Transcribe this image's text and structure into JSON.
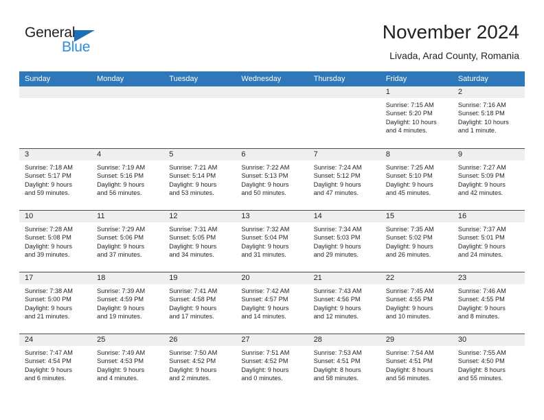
{
  "brand": {
    "name_part1": "General",
    "name_part2": "Blue",
    "accent_color": "#2b8ddc",
    "triangle_color": "#1f6fb5"
  },
  "header": {
    "title": "November 2024",
    "location": "Livada, Arad County, Romania"
  },
  "calendar": {
    "header_color": "#2e77b8",
    "daynum_band_color": "#efeff0",
    "weekday_headers": [
      "Sunday",
      "Monday",
      "Tuesday",
      "Wednesday",
      "Thursday",
      "Friday",
      "Saturday"
    ],
    "weeks": [
      [
        {
          "day": "",
          "lines": []
        },
        {
          "day": "",
          "lines": []
        },
        {
          "day": "",
          "lines": []
        },
        {
          "day": "",
          "lines": []
        },
        {
          "day": "",
          "lines": []
        },
        {
          "day": "1",
          "lines": [
            "Sunrise: 7:15 AM",
            "Sunset: 5:20 PM",
            "Daylight: 10 hours",
            "and 4 minutes."
          ]
        },
        {
          "day": "2",
          "lines": [
            "Sunrise: 7:16 AM",
            "Sunset: 5:18 PM",
            "Daylight: 10 hours",
            "and 1 minute."
          ]
        }
      ],
      [
        {
          "day": "3",
          "lines": [
            "Sunrise: 7:18 AM",
            "Sunset: 5:17 PM",
            "Daylight: 9 hours",
            "and 59 minutes."
          ]
        },
        {
          "day": "4",
          "lines": [
            "Sunrise: 7:19 AM",
            "Sunset: 5:16 PM",
            "Daylight: 9 hours",
            "and 56 minutes."
          ]
        },
        {
          "day": "5",
          "lines": [
            "Sunrise: 7:21 AM",
            "Sunset: 5:14 PM",
            "Daylight: 9 hours",
            "and 53 minutes."
          ]
        },
        {
          "day": "6",
          "lines": [
            "Sunrise: 7:22 AM",
            "Sunset: 5:13 PM",
            "Daylight: 9 hours",
            "and 50 minutes."
          ]
        },
        {
          "day": "7",
          "lines": [
            "Sunrise: 7:24 AM",
            "Sunset: 5:12 PM",
            "Daylight: 9 hours",
            "and 47 minutes."
          ]
        },
        {
          "day": "8",
          "lines": [
            "Sunrise: 7:25 AM",
            "Sunset: 5:10 PM",
            "Daylight: 9 hours",
            "and 45 minutes."
          ]
        },
        {
          "day": "9",
          "lines": [
            "Sunrise: 7:27 AM",
            "Sunset: 5:09 PM",
            "Daylight: 9 hours",
            "and 42 minutes."
          ]
        }
      ],
      [
        {
          "day": "10",
          "lines": [
            "Sunrise: 7:28 AM",
            "Sunset: 5:08 PM",
            "Daylight: 9 hours",
            "and 39 minutes."
          ]
        },
        {
          "day": "11",
          "lines": [
            "Sunrise: 7:29 AM",
            "Sunset: 5:06 PM",
            "Daylight: 9 hours",
            "and 37 minutes."
          ]
        },
        {
          "day": "12",
          "lines": [
            "Sunrise: 7:31 AM",
            "Sunset: 5:05 PM",
            "Daylight: 9 hours",
            "and 34 minutes."
          ]
        },
        {
          "day": "13",
          "lines": [
            "Sunrise: 7:32 AM",
            "Sunset: 5:04 PM",
            "Daylight: 9 hours",
            "and 31 minutes."
          ]
        },
        {
          "day": "14",
          "lines": [
            "Sunrise: 7:34 AM",
            "Sunset: 5:03 PM",
            "Daylight: 9 hours",
            "and 29 minutes."
          ]
        },
        {
          "day": "15",
          "lines": [
            "Sunrise: 7:35 AM",
            "Sunset: 5:02 PM",
            "Daylight: 9 hours",
            "and 26 minutes."
          ]
        },
        {
          "day": "16",
          "lines": [
            "Sunrise: 7:37 AM",
            "Sunset: 5:01 PM",
            "Daylight: 9 hours",
            "and 24 minutes."
          ]
        }
      ],
      [
        {
          "day": "17",
          "lines": [
            "Sunrise: 7:38 AM",
            "Sunset: 5:00 PM",
            "Daylight: 9 hours",
            "and 21 minutes."
          ]
        },
        {
          "day": "18",
          "lines": [
            "Sunrise: 7:39 AM",
            "Sunset: 4:59 PM",
            "Daylight: 9 hours",
            "and 19 minutes."
          ]
        },
        {
          "day": "19",
          "lines": [
            "Sunrise: 7:41 AM",
            "Sunset: 4:58 PM",
            "Daylight: 9 hours",
            "and 17 minutes."
          ]
        },
        {
          "day": "20",
          "lines": [
            "Sunrise: 7:42 AM",
            "Sunset: 4:57 PM",
            "Daylight: 9 hours",
            "and 14 minutes."
          ]
        },
        {
          "day": "21",
          "lines": [
            "Sunrise: 7:43 AM",
            "Sunset: 4:56 PM",
            "Daylight: 9 hours",
            "and 12 minutes."
          ]
        },
        {
          "day": "22",
          "lines": [
            "Sunrise: 7:45 AM",
            "Sunset: 4:55 PM",
            "Daylight: 9 hours",
            "and 10 minutes."
          ]
        },
        {
          "day": "23",
          "lines": [
            "Sunrise: 7:46 AM",
            "Sunset: 4:55 PM",
            "Daylight: 9 hours",
            "and 8 minutes."
          ]
        }
      ],
      [
        {
          "day": "24",
          "lines": [
            "Sunrise: 7:47 AM",
            "Sunset: 4:54 PM",
            "Daylight: 9 hours",
            "and 6 minutes."
          ]
        },
        {
          "day": "25",
          "lines": [
            "Sunrise: 7:49 AM",
            "Sunset: 4:53 PM",
            "Daylight: 9 hours",
            "and 4 minutes."
          ]
        },
        {
          "day": "26",
          "lines": [
            "Sunrise: 7:50 AM",
            "Sunset: 4:52 PM",
            "Daylight: 9 hours",
            "and 2 minutes."
          ]
        },
        {
          "day": "27",
          "lines": [
            "Sunrise: 7:51 AM",
            "Sunset: 4:52 PM",
            "Daylight: 9 hours",
            "and 0 minutes."
          ]
        },
        {
          "day": "28",
          "lines": [
            "Sunrise: 7:53 AM",
            "Sunset: 4:51 PM",
            "Daylight: 8 hours",
            "and 58 minutes."
          ]
        },
        {
          "day": "29",
          "lines": [
            "Sunrise: 7:54 AM",
            "Sunset: 4:51 PM",
            "Daylight: 8 hours",
            "and 56 minutes."
          ]
        },
        {
          "day": "30",
          "lines": [
            "Sunrise: 7:55 AM",
            "Sunset: 4:50 PM",
            "Daylight: 8 hours",
            "and 55 minutes."
          ]
        }
      ]
    ]
  }
}
